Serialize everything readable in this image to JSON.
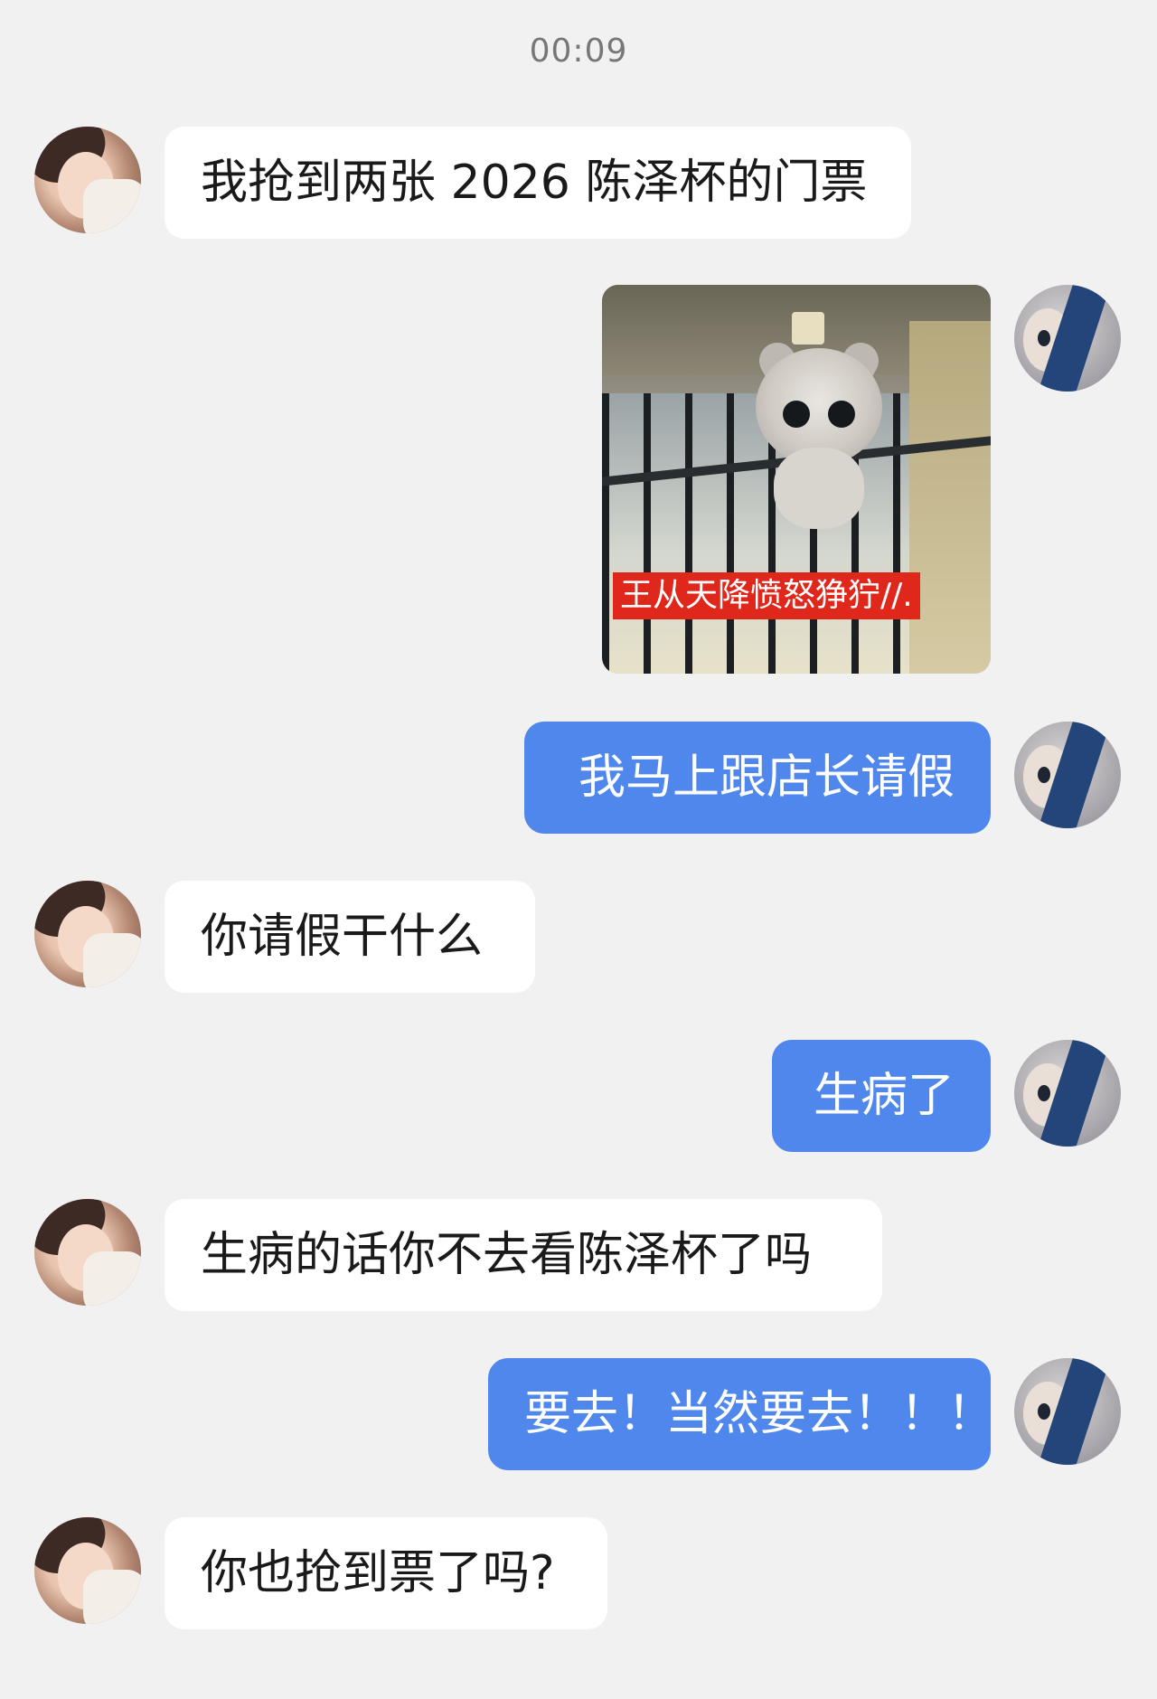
{
  "chat": {
    "timestamp": "00:09",
    "messages": [
      {
        "side": "left",
        "type": "text",
        "text": "我抢到两张 2026 陈泽杯的门票"
      },
      {
        "side": "right",
        "type": "image",
        "caption": "王从天降愤怒狰狞//."
      },
      {
        "side": "right",
        "type": "text",
        "text": "我马上跟店长请假"
      },
      {
        "side": "left",
        "type": "text",
        "text": "你请假干什么"
      },
      {
        "side": "right",
        "type": "text",
        "text": "生病了"
      },
      {
        "side": "left",
        "type": "text",
        "text": "生病的话你不去看陈泽杯了吗"
      },
      {
        "side": "right",
        "type": "text",
        "text": "要去！当然要去！！！"
      },
      {
        "side": "left",
        "type": "text",
        "text": "你也抢到票了吗?"
      }
    ]
  },
  "colors": {
    "background": "#f1f1f1",
    "incoming_bubble": "#ffffff",
    "outgoing_bubble": "#4f87ec",
    "timestamp_text": "#777777",
    "caption_bg": "#e0271b"
  },
  "icons": {
    "left_avatar": "user-avatar-photo",
    "right_avatar": "user-avatar-anime"
  }
}
